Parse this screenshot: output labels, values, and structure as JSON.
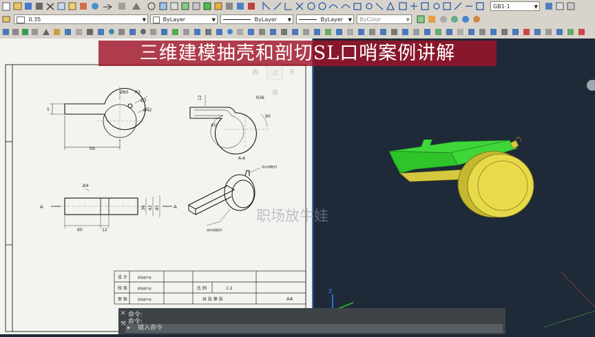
{
  "toolbar": {
    "lineweight_value": "0.35",
    "layer_value": "ByLayer",
    "linetype_value": "ByLayer",
    "lineweight2_value": "ByLayer",
    "color_value": "ByColor",
    "style_value": "GB1-1"
  },
  "video": {
    "title": "三维建模抽壳和剖切SL口哨案例讲解",
    "watermark": "职场放牛娃"
  },
  "drawing": {
    "dims": [
      "Ø60",
      "R3",
      "Ø3",
      "Ø42",
      "12",
      "R36",
      "R9",
      "45°",
      "90",
      "60",
      "12",
      "Ø4",
      "36",
      "42",
      "45",
      "5",
      "R4"
    ],
    "section_label": "A-A",
    "a_left": "A",
    "a_right": "A",
    "callout1": "流水线路径3",
    "callout2": "流水线路径3",
    "title_block": {
      "design": "设 计",
      "check": "校 核",
      "review": "审 核",
      "design_name": "职场放牛娃",
      "check_name": "职场放牛娃",
      "review_name": "职场放牛娃",
      "scale_label": "比 例",
      "scale_value": "1:2",
      "sheets": "共  张  第  张",
      "size": "A4"
    },
    "viewcube": {
      "top": "上",
      "left": "西",
      "right": "东",
      "front": "南"
    }
  },
  "command": {
    "history1": "命令:",
    "history2": "命令:",
    "placeholder": "键入命令"
  },
  "colors": {
    "toolbar_bg": "#d8d4cc",
    "paper_bg": "#f3f3ef",
    "model_bg": "#1e2a38",
    "banner": "#a01428",
    "whistle_yellow": "#e6d94a",
    "whistle_green": "#3fd63a"
  }
}
